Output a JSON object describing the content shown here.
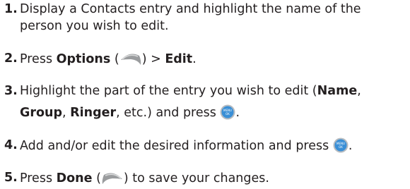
{
  "steps": [
    {
      "number": "1.",
      "line1": "Display a Contacts entry and highlight the name of the",
      "line2": "person you wish to edit."
    },
    {
      "number": "2.",
      "press": "Press ",
      "options": "Options",
      "open_paren": " (",
      "close_paren_arrow": ") > ",
      "edit": "Edit",
      "period": "."
    },
    {
      "number": "3.",
      "line1_start": "Highlight the part of the entry you wish to edit (",
      "name": "Name",
      "comma1": ",",
      "group": "Group",
      "comma2": ", ",
      "ringer": "Ringer",
      "line2_end": ", etc.) and press ",
      "period": "."
    },
    {
      "number": "4.",
      "text": "Add and/or edit the desired information and press ",
      "period": "."
    },
    {
      "number": "5.",
      "press": "Press ",
      "done": "Done",
      "open_paren": " (",
      "close_paren": ") to save your changes."
    }
  ],
  "icons": {
    "right_softkey": "right-softkey-icon",
    "left_softkey": "left-softkey-icon",
    "menu_ok": "menu-ok-key-icon",
    "menu_ok_label_top": "MENU",
    "menu_ok_label_bottom": "OK"
  },
  "colors": {
    "text": "#231f20",
    "key_blue": "#3a8fd6",
    "softkey_gray": "#8a8c8e"
  }
}
